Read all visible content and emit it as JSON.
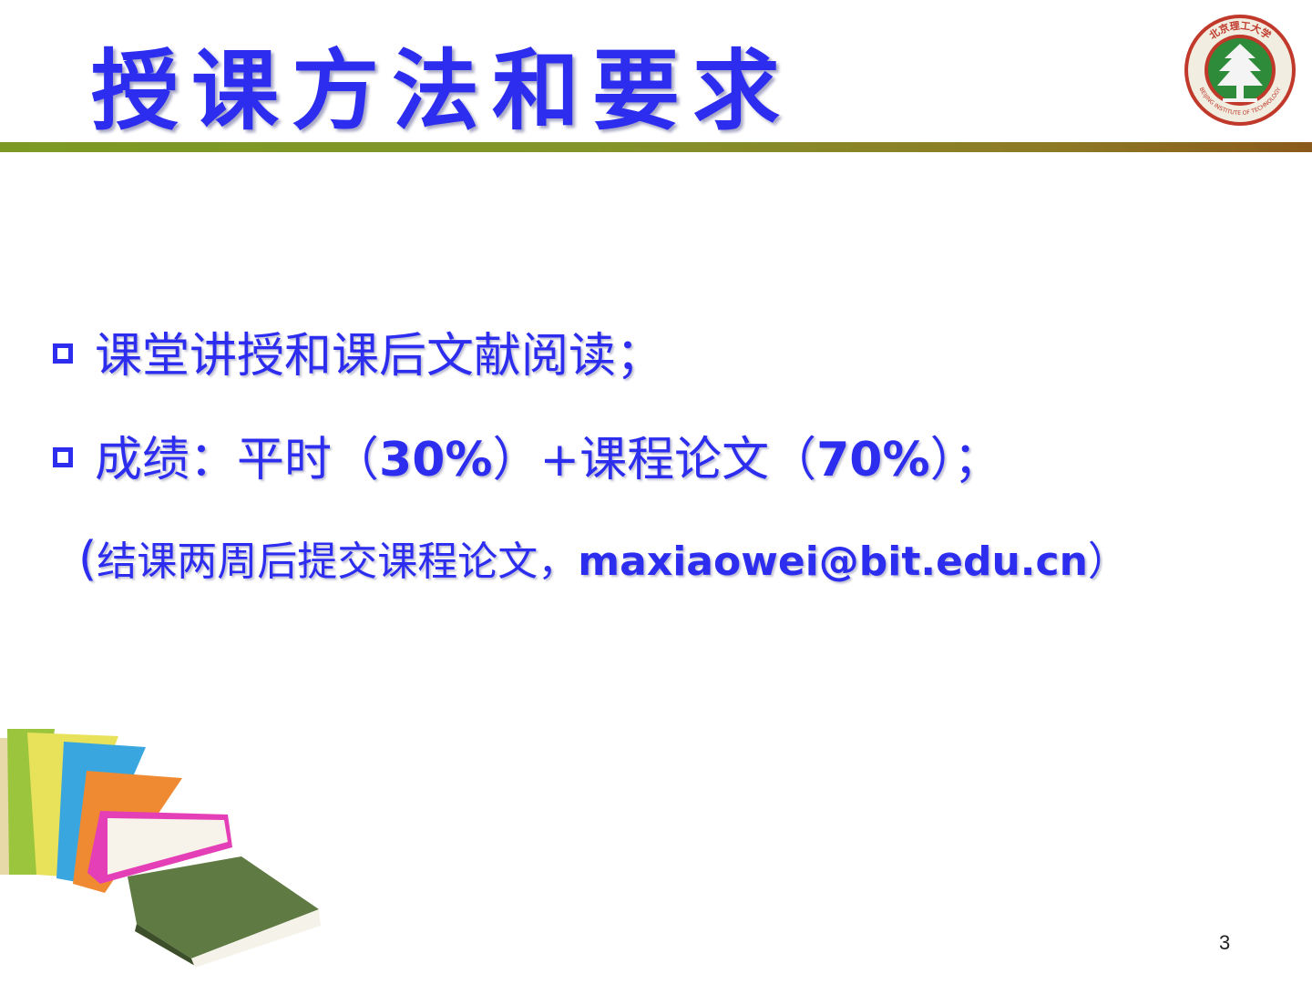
{
  "slide": {
    "title": "授课方法和要求",
    "page_number": "3"
  },
  "logo": {
    "arc_text_top": "北京理工大学",
    "arc_text_bottom": "BEIJING INSTITUTE OF TECHNOLOGY"
  },
  "bullets": [
    {
      "text": "课堂讲授和课后文献阅读；"
    },
    {
      "prefix": "成绩：平时",
      "paren_open_1": "（",
      "value_1": "30%",
      "mid": "）+课程论文",
      "paren_open_2": "（",
      "value_2": "70%",
      "suffix": "）；"
    }
  ],
  "note": {
    "paren_open": "(",
    "text": "结课两周后提交课程论文，",
    "email": "maxiaowei@bit.edu.cn",
    "paren_close": "）"
  },
  "colors": {
    "text_blue": "#2d2df0",
    "rule_green": "#7c9a23",
    "rule_brown": "#8a5a1c",
    "logo_red": "#c0392b",
    "logo_green": "#2e8b3a"
  },
  "icons": {
    "bullet": "hollow-square-bullet-icon",
    "decoration": "stacked-books-illustration"
  }
}
